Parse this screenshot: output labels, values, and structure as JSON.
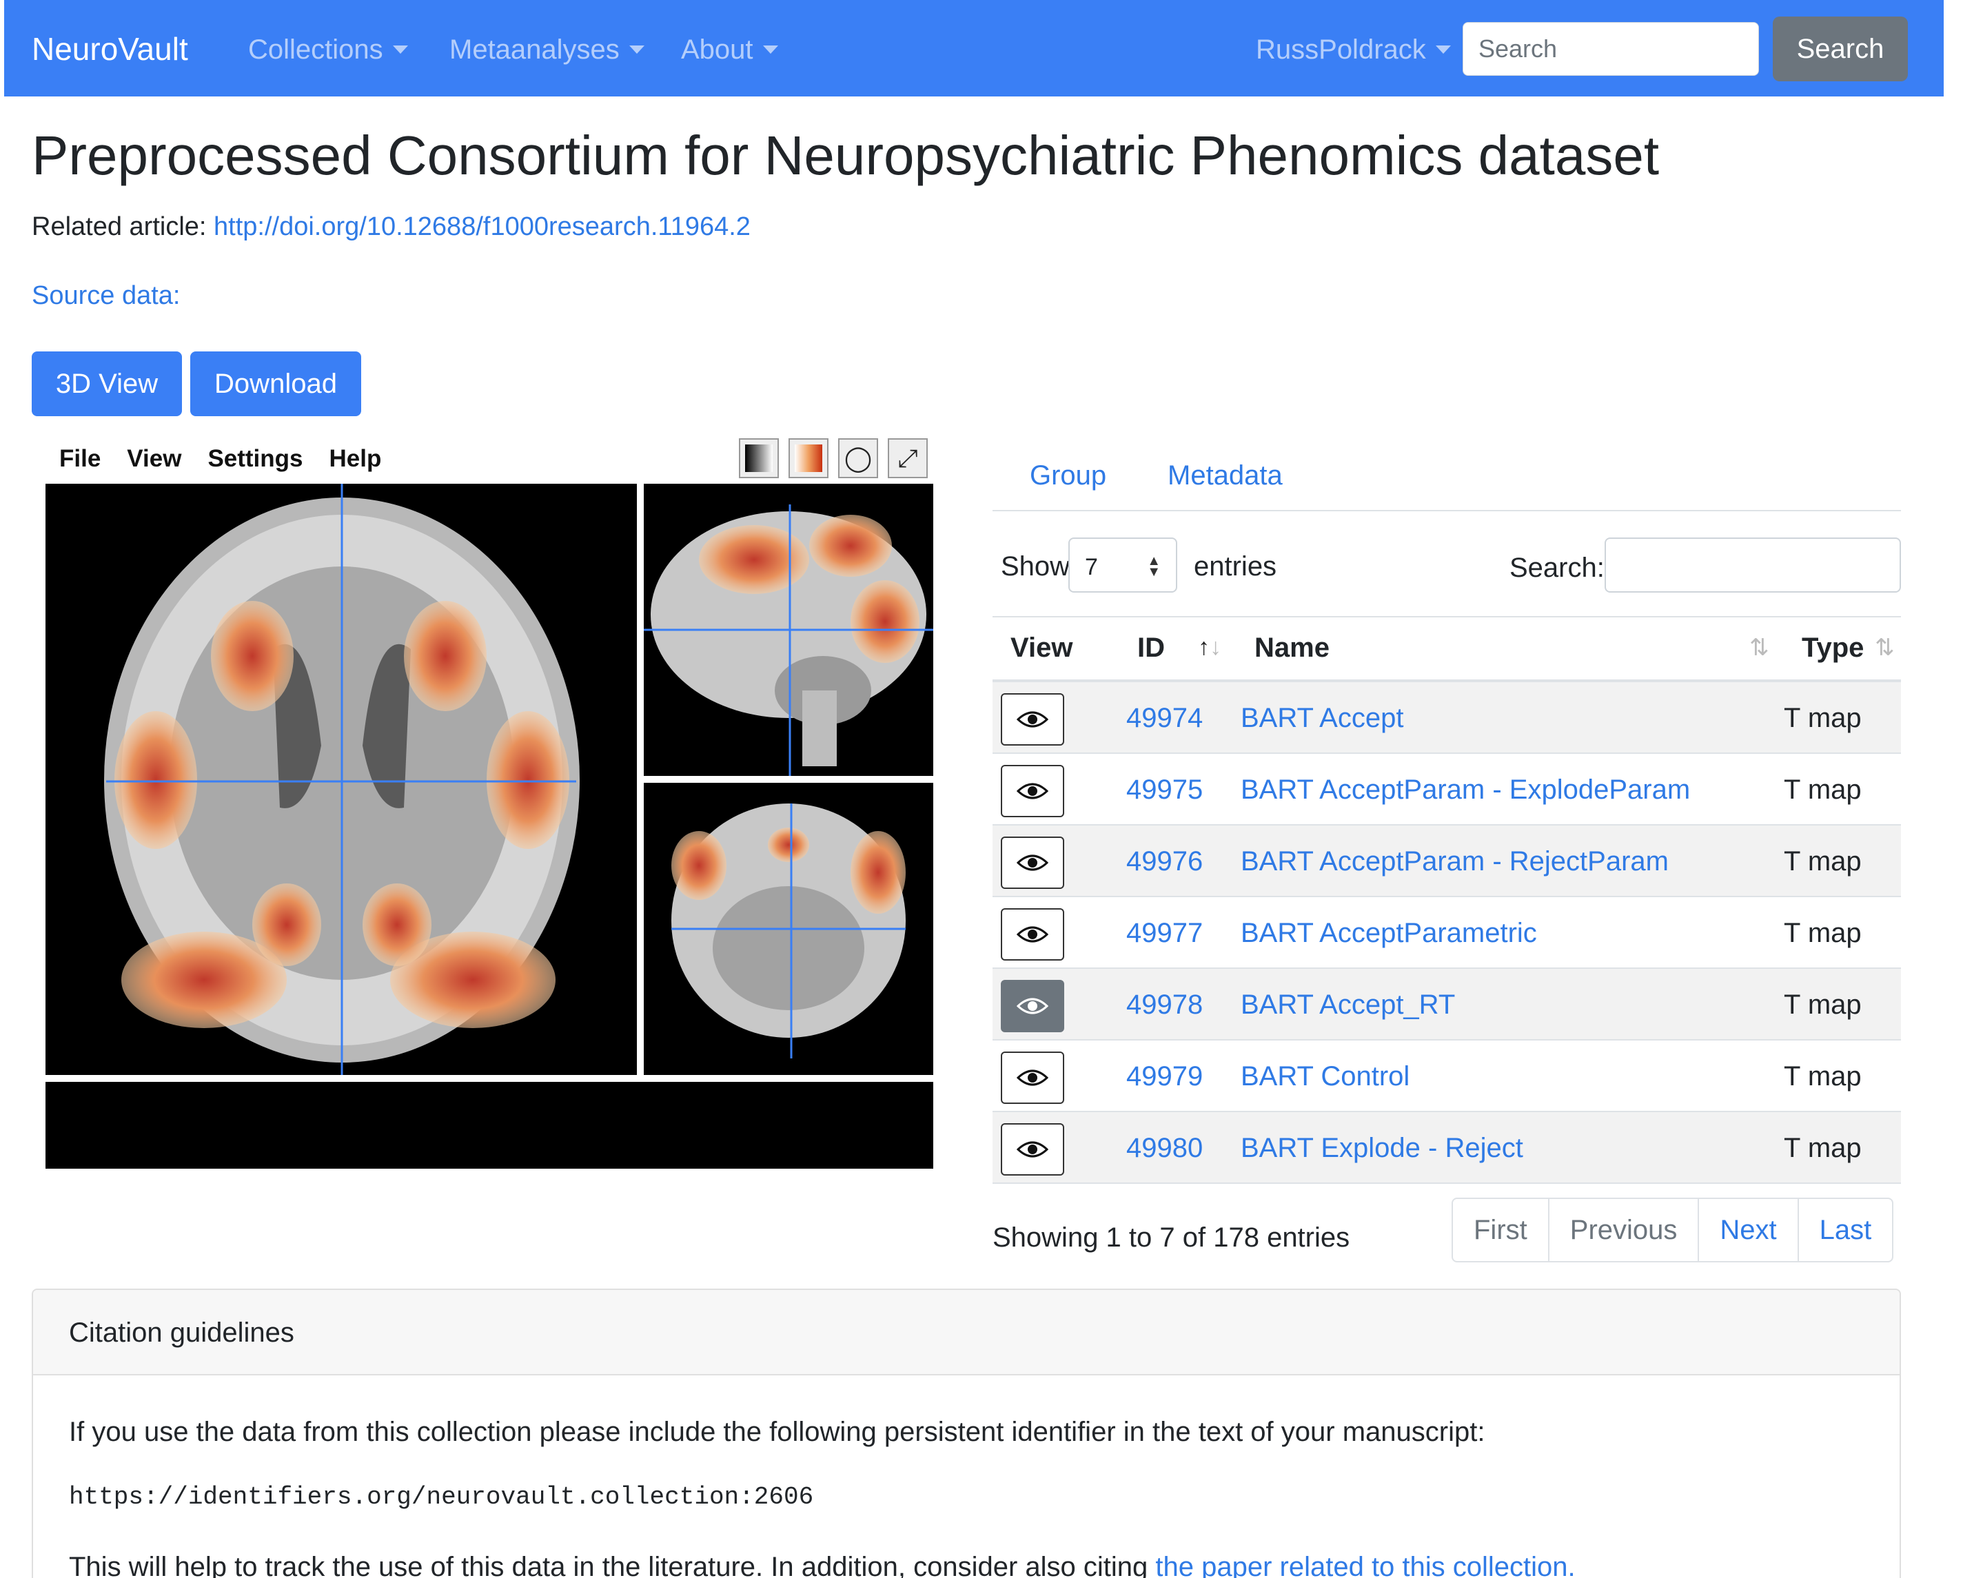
{
  "navbar": {
    "brand": "NeuroVault",
    "menu": [
      "Collections",
      "Metaanalyses",
      "About"
    ],
    "user": "RussPoldrack",
    "search_placeholder": "Search",
    "search_button": "Search"
  },
  "header": {
    "title": "Preprocessed Consortium for Neuropsychiatric Phenomics dataset",
    "related_label": "Related article:",
    "related_url": "http://doi.org/10.12688/f1000research.11964.2",
    "source_label": "Source data:"
  },
  "buttons": {
    "view3d": "3D View",
    "download": "Download"
  },
  "viewer": {
    "menu": [
      "File",
      "View",
      "Settings",
      "Help"
    ],
    "tools": [
      "grayscale-icon",
      "colormap-icon",
      "globe-icon",
      "fullscreen-icon"
    ]
  },
  "tabs": [
    "Group",
    "Metadata"
  ],
  "datatable": {
    "show_label": "Show",
    "page_length": "7",
    "entries_label": "entries",
    "search_label": "Search:",
    "columns": [
      "View",
      "ID",
      "Name",
      "Type"
    ],
    "rows": [
      {
        "id": "49974",
        "name": "BART Accept",
        "type": "T map"
      },
      {
        "id": "49975",
        "name": "BART AcceptParam - ExplodeParam",
        "type": "T map"
      },
      {
        "id": "49976",
        "name": "BART AcceptParam - RejectParam",
        "type": "T map"
      },
      {
        "id": "49977",
        "name": "BART AcceptParametric",
        "type": "T map"
      },
      {
        "id": "49978",
        "name": "BART Accept_RT",
        "type": "T map"
      },
      {
        "id": "49979",
        "name": "BART Control",
        "type": "T map"
      },
      {
        "id": "49980",
        "name": "BART Explode - Reject",
        "type": "T map"
      }
    ],
    "info": "Showing 1 to 7 of 178 entries",
    "pager": [
      "First",
      "Previous",
      "Next",
      "Last"
    ]
  },
  "citation": {
    "title": "Citation guidelines",
    "text1": "If you use the data from this collection please include the following persistent identifier in the text of your manuscript:",
    "identifier": "https://identifiers.org/neurovault.collection:2606",
    "text2": "This will help to track the use of this data in the literature. In addition, consider also citing ",
    "link": "the paper related to this collection."
  },
  "colors": {
    "primary": "#3a7ff5",
    "link": "#2f7ae5",
    "secondary": "#6c757d"
  }
}
